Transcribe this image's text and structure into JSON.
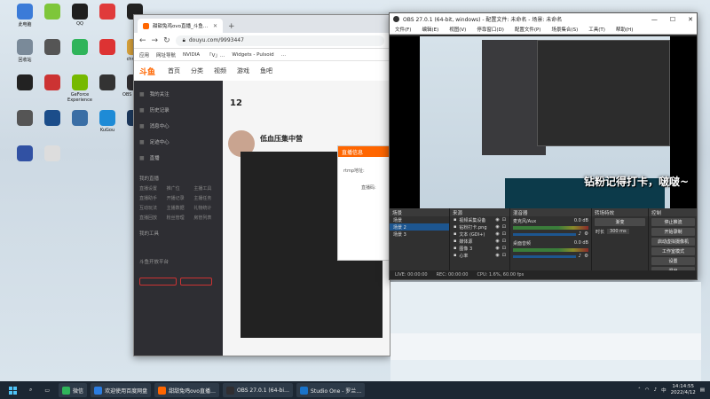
{
  "desktop": {
    "icons": [
      {
        "label": "此电脑",
        "color": "#3b7bd8"
      },
      {
        "label": "",
        "color": "#7ec63a"
      },
      {
        "label": "QQ",
        "color": "#1f1f1f"
      },
      {
        "label": "",
        "color": "#e03b3b"
      },
      {
        "label": "",
        "color": "#222"
      },
      {
        "label": "",
        "color": "#c33"
      },
      {
        "label": "回收站",
        "color": "#7a8a99"
      },
      {
        "label": "",
        "color": "#555"
      },
      {
        "label": "",
        "color": "#2fb45a"
      },
      {
        "label": "",
        "color": "#d33"
      },
      {
        "label": "chrome",
        "color": "#d8a23b"
      },
      {
        "label": "",
        "color": "#e4a000"
      },
      {
        "label": "",
        "color": "#222"
      },
      {
        "label": "",
        "color": "#c33"
      },
      {
        "label": "GeForce Experience",
        "color": "#76b900"
      },
      {
        "label": "",
        "color": "#333"
      },
      {
        "label": "OBS Studio",
        "color": "#302e31"
      },
      {
        "label": "",
        "color": "#f28b1e"
      },
      {
        "label": "",
        "color": "#555"
      },
      {
        "label": "",
        "color": "#1b4d8a"
      },
      {
        "label": "",
        "color": "#3a6ea5"
      },
      {
        "label": "KuGou",
        "color": "#1e8bd6"
      },
      {
        "label": "",
        "color": "#1e3a5f"
      },
      {
        "label": "",
        "color": "#e6c323"
      },
      {
        "label": "",
        "color": "#3151a3"
      },
      {
        "label": "",
        "color": "#ddd"
      }
    ],
    "caption": "钻粉记得打卡，啵啵~"
  },
  "browser": {
    "tab_title": "甜甜兔鸡ovo直播_斗鱼…",
    "new_tab": "+",
    "address": "douyu.com/9993447",
    "bookmarks": [
      "应用",
      "网址导航",
      "NVIDIA",
      "「V」…",
      "Widgets - Pulsoid",
      "…"
    ],
    "douyu": {
      "logo": "斗鱼",
      "nav": [
        "首页",
        "分类",
        "视频",
        "游戏",
        "鱼吧"
      ],
      "side_items": [
        "我的关注",
        "历史记录",
        "消息中心",
        "足迹中心",
        "直播"
      ],
      "side_section": "我的直播",
      "side_grid": [
        "直播设置",
        "推广位",
        "主播工具",
        "直播助手",
        "开播记录",
        "主播任务",
        "互动玩法",
        "主播数据",
        "礼物统计",
        "直播回放",
        "粉丝管理",
        "房管列表"
      ],
      "side_section2": "我的工具",
      "side_section3": "斗鱼开放平台",
      "room_title": "低血压集中营",
      "modal_title": "直播信息",
      "modal_label1": "rtmp地址:",
      "modal_label2": "直播码:",
      "stat_number": "12"
    }
  },
  "obs": {
    "title": "OBS 27.0.1 (64-bit, windows) - 配置文件: 未命名 - 场景: 未命名",
    "menu": [
      "文件(F)",
      "编辑(E)",
      "视图(V)",
      "停靠窗口(D)",
      "配置文件(P)",
      "场景集合(S)",
      "工具(T)",
      "帮助(H)"
    ],
    "docks": {
      "scene_header": "场景",
      "scenes": [
        "场景",
        "场景 2",
        "场景 3"
      ],
      "source_header": "来源",
      "sources": [
        "视频采集设备",
        "钻粉打卡.png",
        "文本 (GDI+)",
        "媒体源",
        "图像 3",
        "心率"
      ],
      "mixer_header": "混音器",
      "mixer_tracks": [
        {
          "name": "麦克风/Aux",
          "db": "0.0 dB"
        },
        {
          "name": "桌面音频",
          "db": "0.0 dB"
        }
      ],
      "transition_header": "转场特效",
      "transition_value": "渐变",
      "duration_label": "时长",
      "duration_value": "300 ms",
      "controls_header": "控制",
      "controls": [
        "停止推流",
        "开始录制",
        "启动虚拟摄像机",
        "工作室模式",
        "设置",
        "退出"
      ]
    },
    "status": [
      "LIVE: 00:00:00",
      "REC: 00:00:00",
      "CPU: 1.6%, 60.00 fps"
    ]
  },
  "taskbar": {
    "apps": [
      "微信",
      "欢迎使用百度网盘",
      "甜甜兔鸡ovo直播…",
      "OBS 27.0.1 (64-bi…",
      "Studio One - 罗兰…"
    ],
    "time": "14:14:55",
    "date": "2022/4/12",
    "lang": "中"
  }
}
